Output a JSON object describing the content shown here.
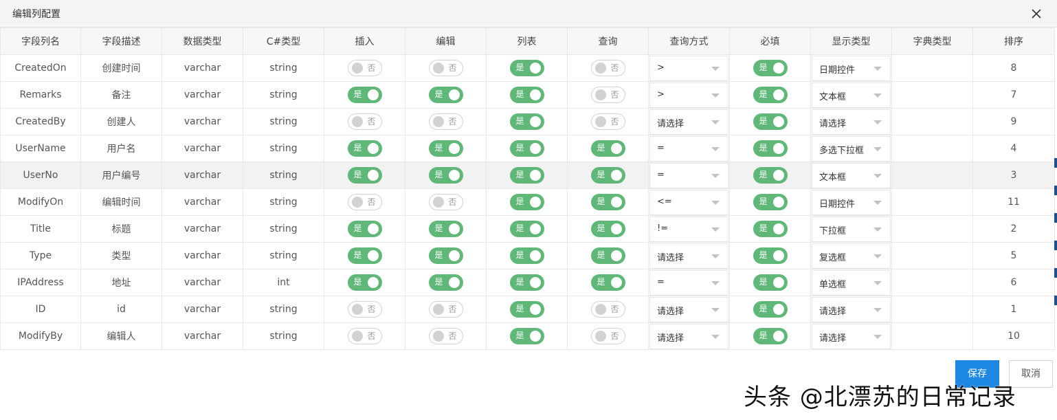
{
  "dialog": {
    "title": "编辑列配置",
    "close_icon": "close-icon"
  },
  "columns": [
    "字段列名",
    "字段描述",
    "数据类型",
    "C#类型",
    "插入",
    "编辑",
    "列表",
    "查询",
    "查询方式",
    "必填",
    "显示类型",
    "字典类型",
    "排序"
  ],
  "switch_on": "是",
  "switch_off": "否",
  "rows": [
    {
      "name": "CreatedOn",
      "desc": "创建时间",
      "dbtype": "varchar",
      "cstype": "string",
      "insert": false,
      "edit": false,
      "list": true,
      "query": false,
      "query_mode": ">",
      "required": true,
      "display_type": "日期控件",
      "dict": "",
      "order": "8"
    },
    {
      "name": "Remarks",
      "desc": "备注",
      "dbtype": "varchar",
      "cstype": "string",
      "insert": true,
      "edit": true,
      "list": true,
      "query": false,
      "query_mode": ">",
      "required": true,
      "display_type": "文本框",
      "dict": "",
      "order": "7"
    },
    {
      "name": "CreatedBy",
      "desc": "创建人",
      "dbtype": "varchar",
      "cstype": "string",
      "insert": false,
      "edit": false,
      "list": true,
      "query": false,
      "query_mode": "请选择",
      "required": true,
      "display_type": "请选择",
      "dict": "",
      "order": "9"
    },
    {
      "name": "UserName",
      "desc": "用户名",
      "dbtype": "varchar",
      "cstype": "string",
      "insert": true,
      "edit": true,
      "list": true,
      "query": true,
      "query_mode": "=",
      "required": true,
      "display_type": "多选下拉框",
      "dict": "",
      "order": "4"
    },
    {
      "name": "UserNo",
      "desc": "用户编号",
      "dbtype": "varchar",
      "cstype": "string",
      "insert": true,
      "edit": true,
      "list": true,
      "query": true,
      "query_mode": "=",
      "required": true,
      "display_type": "文本框",
      "dict": "",
      "order": "3",
      "highlight": true
    },
    {
      "name": "ModifyOn",
      "desc": "编辑时间",
      "dbtype": "varchar",
      "cstype": "string",
      "insert": false,
      "edit": false,
      "list": true,
      "query": true,
      "query_mode": "<=",
      "required": true,
      "display_type": "日期控件",
      "dict": "",
      "order": "11"
    },
    {
      "name": "Title",
      "desc": "标题",
      "dbtype": "varchar",
      "cstype": "string",
      "insert": true,
      "edit": true,
      "list": true,
      "query": true,
      "query_mode": "!=",
      "required": true,
      "display_type": "下拉框",
      "dict": "",
      "order": "2"
    },
    {
      "name": "Type",
      "desc": "类型",
      "dbtype": "varchar",
      "cstype": "string",
      "insert": true,
      "edit": true,
      "list": true,
      "query": true,
      "query_mode": "请选择",
      "required": true,
      "display_type": "复选框",
      "dict": "",
      "order": "5"
    },
    {
      "name": "IPAddress",
      "desc": "地址",
      "dbtype": "varchar",
      "cstype": "int",
      "insert": true,
      "edit": true,
      "list": true,
      "query": true,
      "query_mode": "=",
      "required": true,
      "display_type": "单选框",
      "dict": "",
      "order": "6"
    },
    {
      "name": "ID",
      "desc": "id",
      "dbtype": "varchar",
      "cstype": "string",
      "insert": false,
      "edit": false,
      "list": true,
      "query": false,
      "query_mode": "请选择",
      "required": true,
      "display_type": "请选择",
      "dict": "",
      "order": "1"
    },
    {
      "name": "ModifyBy",
      "desc": "编辑人",
      "dbtype": "varchar",
      "cstype": "string",
      "insert": false,
      "edit": false,
      "list": true,
      "query": false,
      "query_mode": "请选择",
      "required": true,
      "display_type": "请选择",
      "dict": "",
      "order": "10"
    }
  ],
  "footer": {
    "save_label": "保存",
    "cancel_label": "取消"
  },
  "watermark": "头条 @北漂苏的日常记录",
  "colors": {
    "switch_on": "#5fb878",
    "save_button": "#1e88e5",
    "header_bg": "#f4f4f4"
  }
}
